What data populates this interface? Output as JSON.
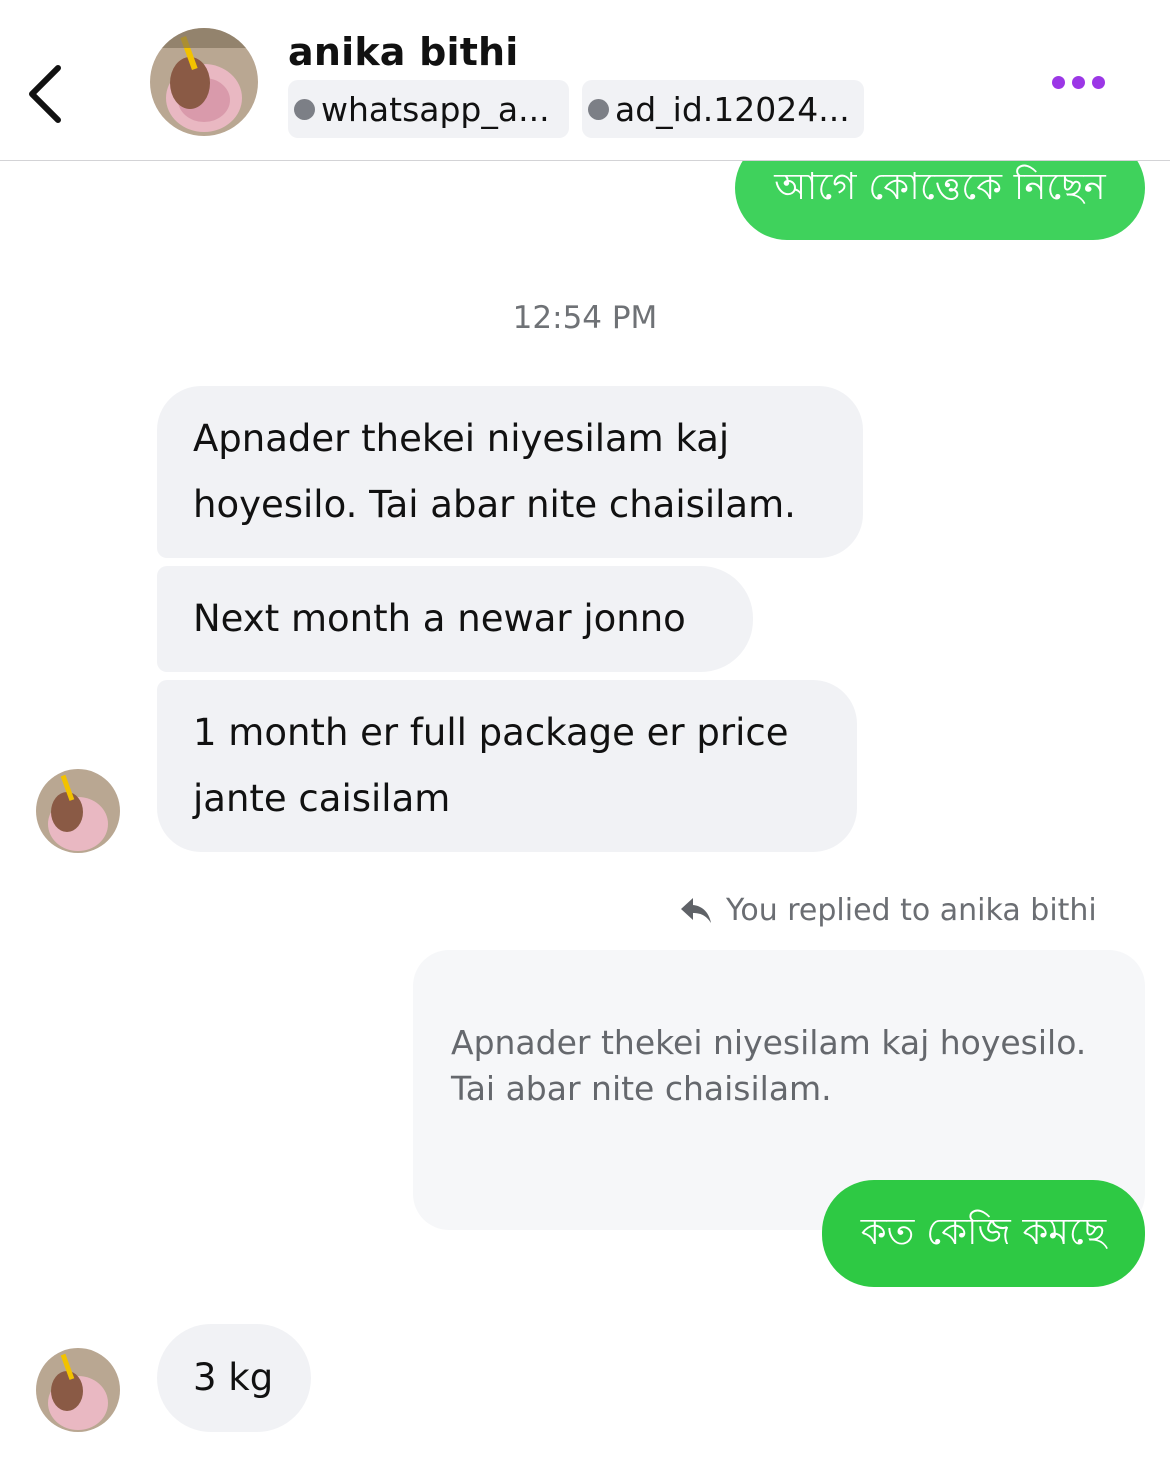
{
  "header": {
    "contact_name": "anika bithi",
    "tags": [
      "whatsapp_a...",
      "ad_id.12024..."
    ],
    "accent_color": "#9b37e6"
  },
  "messages": {
    "out_top": "আগে কোত্তেকে নিছেন",
    "timestamp": "12:54 PM",
    "in_group": [
      "Apnader thekei niyesilam kaj hoyesilo. Tai abar nite chaisilam.",
      "Next month a newar jonno",
      "1 month er full package er price jante caisilam"
    ],
    "reply_note": "You replied to anika bithi",
    "quoted_text": "Apnader thekei niyesilam kaj hoyesilo. Tai abar nite chaisilam.",
    "out_reply": "কত কেজি কমছে",
    "in_last": "3 kg"
  },
  "colors": {
    "outgoing_bubble": "#3fd25c",
    "incoming_bubble": "#f1f2f5"
  },
  "icons": [
    "back-arrow-icon",
    "more-options-icon",
    "reply-icon",
    "avatar"
  ]
}
